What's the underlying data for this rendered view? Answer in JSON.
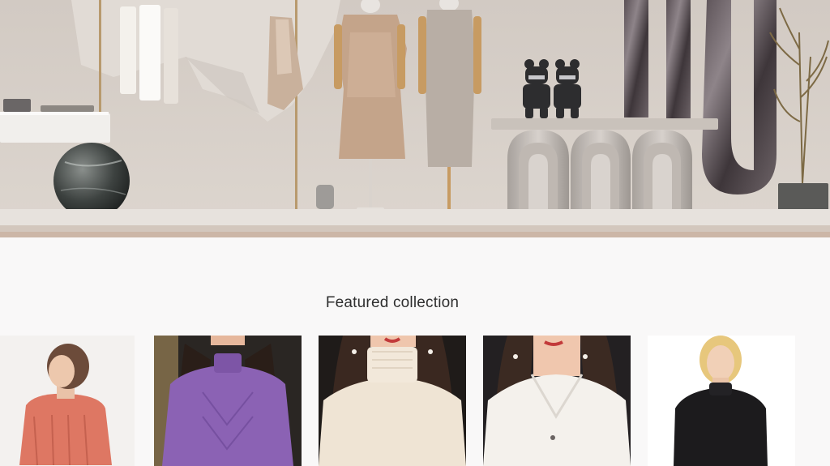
{
  "hero": {
    "scene": "boutique-display-banner"
  },
  "featured": {
    "title": "Featured collection",
    "products": [
      {
        "name": "coral-cable-knit-sweater",
        "color": "#de7763"
      },
      {
        "name": "purple-mock-neck-sweater",
        "color": "#8b62b4"
      },
      {
        "name": "cream-turtleneck-sweater",
        "color": "#efe4d4"
      },
      {
        "name": "white-button-collar-cardigan",
        "color": "#f4f1ec"
      },
      {
        "name": "black-turtleneck-sweater",
        "color": "#1c1b1d"
      }
    ]
  }
}
